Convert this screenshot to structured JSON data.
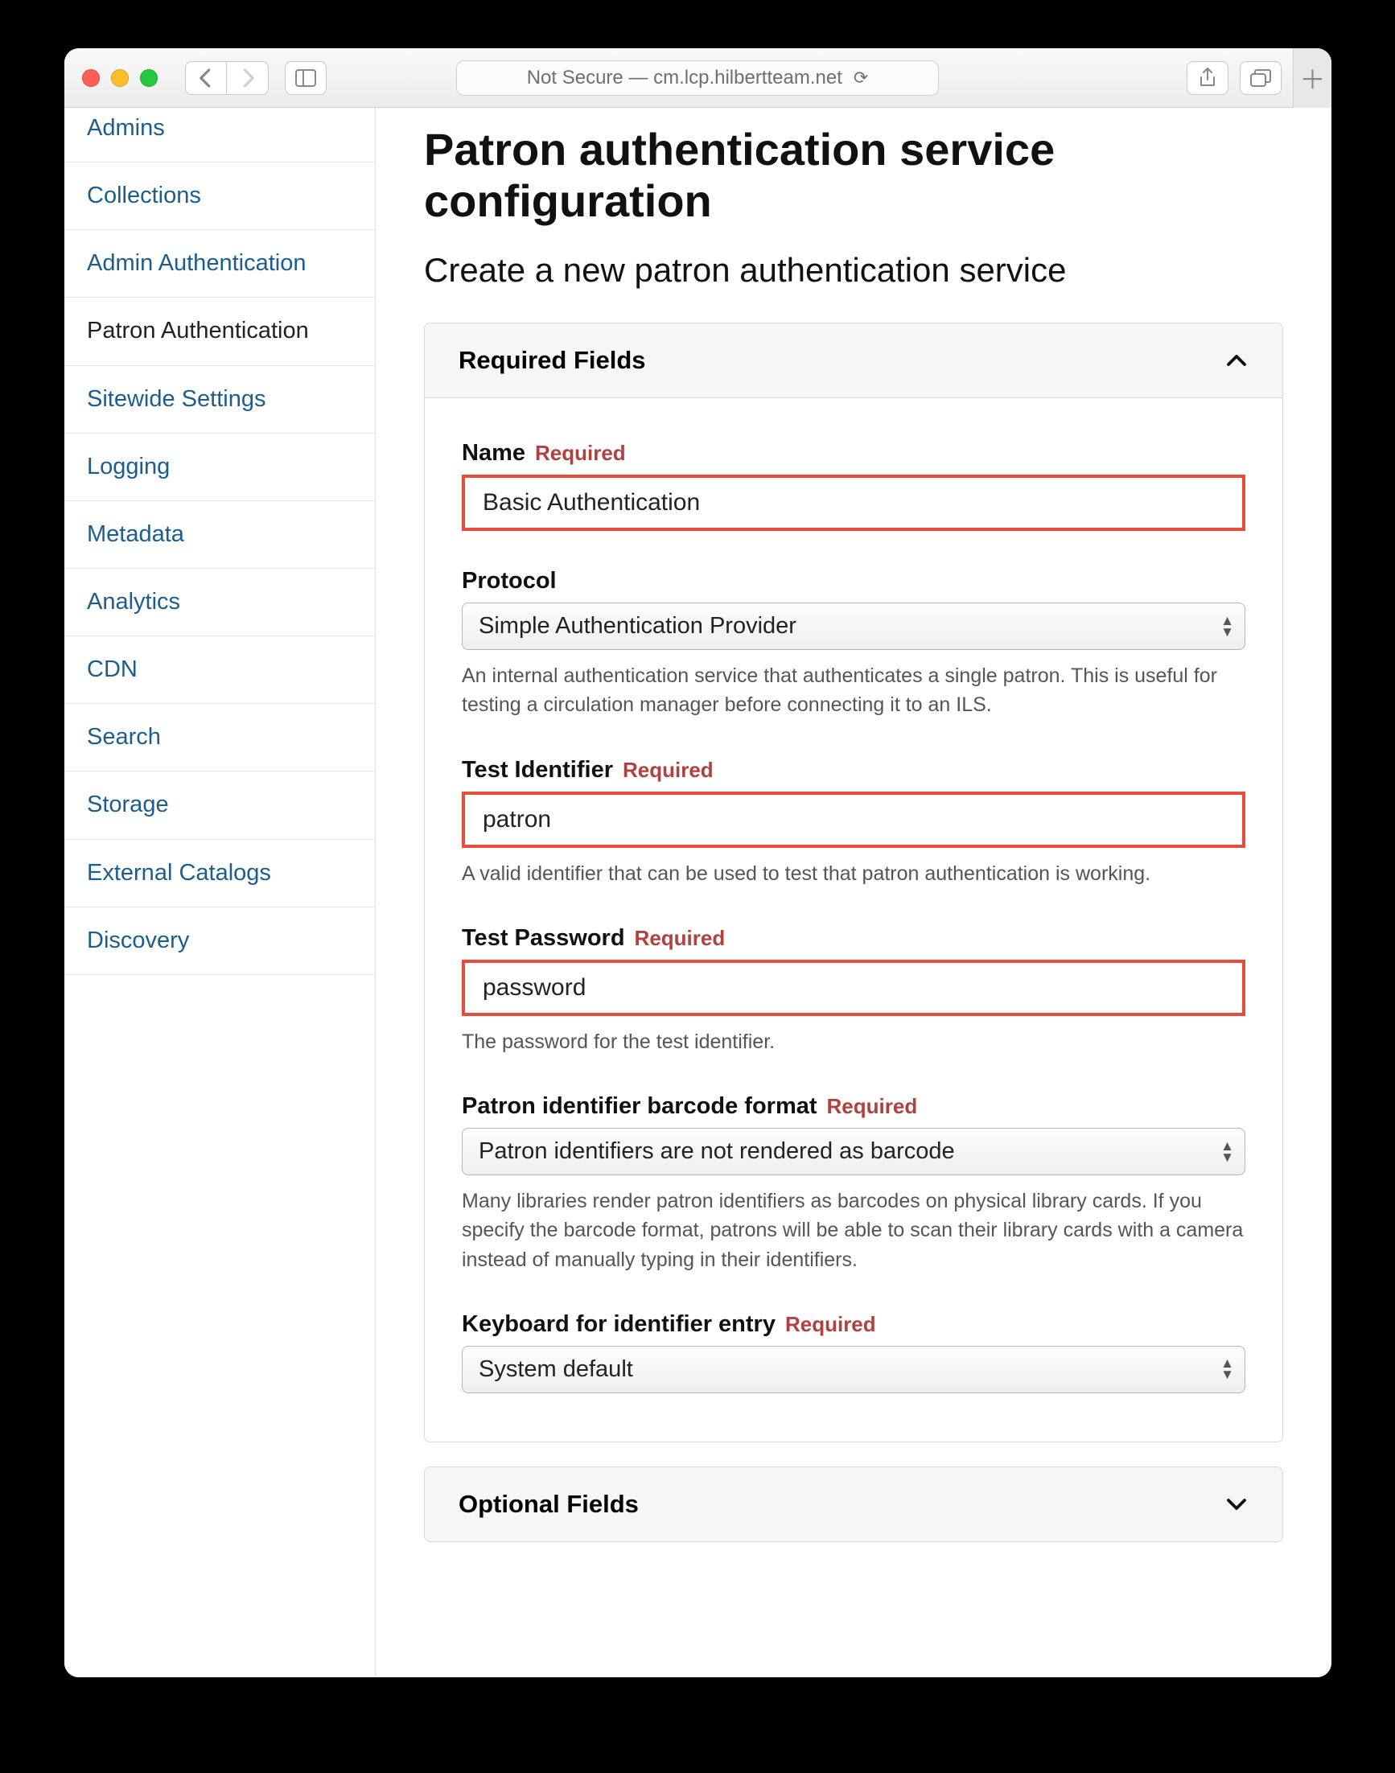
{
  "browser": {
    "address": "Not Secure — cm.lcp.hilbertteam.net"
  },
  "sidebar": {
    "items": [
      {
        "label": "Admins"
      },
      {
        "label": "Collections"
      },
      {
        "label": "Admin Authentication"
      },
      {
        "label": "Patron Authentication"
      },
      {
        "label": "Sitewide Settings"
      },
      {
        "label": "Logging"
      },
      {
        "label": "Metadata"
      },
      {
        "label": "Analytics"
      },
      {
        "label": "CDN"
      },
      {
        "label": "Search"
      },
      {
        "label": "Storage"
      },
      {
        "label": "External Catalogs"
      },
      {
        "label": "Discovery"
      }
    ]
  },
  "page": {
    "title": "Patron authentication service configuration",
    "subtitle": "Create a new patron authentication service"
  },
  "labels": {
    "required_tag": "Required",
    "required_section": "Required Fields",
    "optional_section": "Optional Fields"
  },
  "fields": {
    "name": {
      "label": "Name",
      "value": "Basic Authentication",
      "required": true
    },
    "protocol": {
      "label": "Protocol",
      "value": "Simple Authentication Provider",
      "help": "An internal authentication service that authenticates a single patron. This is useful for testing a circulation manager before connecting it to an ILS."
    },
    "test_identifier": {
      "label": "Test Identifier",
      "value": "patron",
      "required": true,
      "help": "A valid identifier that can be used to test that patron authentication is working."
    },
    "test_password": {
      "label": "Test Password",
      "value": "password",
      "required": true,
      "help": "The password for the test identifier."
    },
    "barcode_format": {
      "label": "Patron identifier barcode format",
      "value": "Patron identifiers are not rendered as barcode",
      "required": true,
      "help": "Many libraries render patron identifiers as barcodes on physical library cards. If you specify the barcode format, patrons will be able to scan their library cards with a camera instead of manually typing in their identifiers."
    },
    "keyboard": {
      "label": "Keyboard for identifier entry",
      "value": "System default",
      "required": true
    }
  }
}
